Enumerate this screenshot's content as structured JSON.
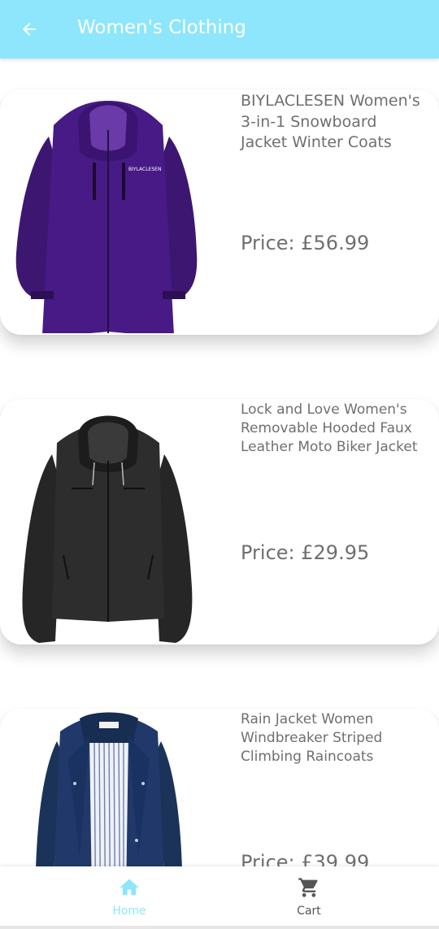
{
  "appbar": {
    "title": "Women's Clothing",
    "back_icon": "arrow-back-icon",
    "background": "#8de6fb"
  },
  "products": [
    {
      "title": "BIYLACLESEN Women's 3-in-1 Snowboard Jacket Winter Coats",
      "price": "Price: £56.99",
      "image": "purple-jacket",
      "color": "#3a1470"
    },
    {
      "title": "Lock and Love Women's Removable Hooded Faux Leather Moto Biker Jacket",
      "price": "Price: £29.95",
      "image": "black-leather-jacket",
      "color": "#1f1f1f"
    },
    {
      "title": "Rain Jacket Women Windbreaker Striped Climbing Raincoats",
      "price": "Price: £39.99",
      "image": "navy-rain-jacket",
      "color": "#1c3660"
    }
  ],
  "bottom_nav": {
    "items": [
      {
        "label": "Home",
        "icon": "home-icon",
        "active": true
      },
      {
        "label": "Cart",
        "icon": "cart-icon",
        "active": false
      }
    ],
    "active_color": "#8de6fb",
    "inactive_color": "#555555"
  }
}
